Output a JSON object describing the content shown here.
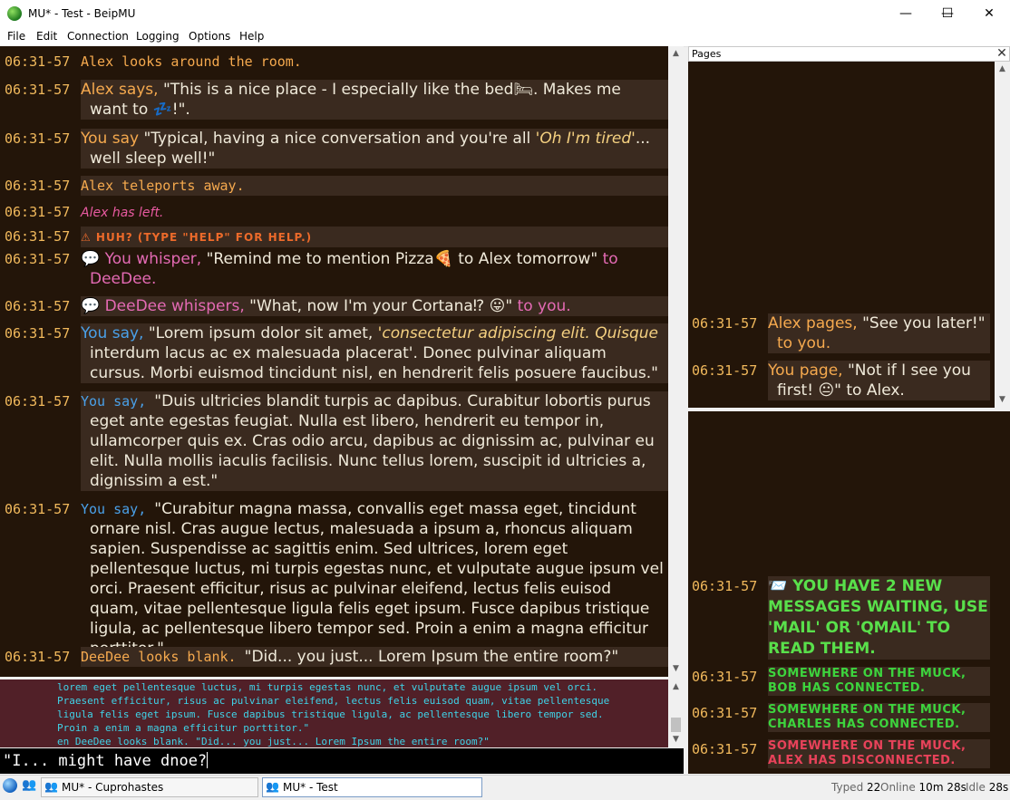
{
  "window": {
    "title": "MU* - Test - BeipMU",
    "minimize": "—",
    "maximize": "☐",
    "close": "✕"
  },
  "menu": [
    "File",
    "Edit",
    "Connection",
    "Logging",
    "Options",
    "Help"
  ],
  "main_lines": [
    {
      "ts": "06:31-57",
      "parts": [
        [
          "orange mono",
          "Alex looks around the room."
        ]
      ]
    },
    {
      "ts": "06:31-57",
      "parts": [
        [
          "orange",
          "Alex says, "
        ],
        [
          "",
          "\"This is a nice place - I especially like the bed🛏. Makes me"
        ]
      ],
      "cont": "want to 💤!\"."
    },
    {
      "ts": "06:31-57",
      "parts": [
        [
          "orange",
          "You say "
        ],
        [
          "",
          "\"Typical,  having a nice conversation and you're all "
        ],
        [
          "ital",
          "'Oh I'm tired'"
        ],
        [
          "",
          "..."
        ]
      ],
      "cont": "well sleep well!\""
    },
    {
      "ts": "06:31-57",
      "parts": [
        [
          "orange mono",
          "Alex teleports away."
        ]
      ]
    },
    {
      "ts": "06:31-57",
      "parts": [
        [
          "pinkit",
          "Alex has left."
        ]
      ]
    },
    {
      "ts": "06:31-57",
      "parts": [
        [
          "huh",
          "⚠ HUH?  (TYPE \"HELP\" FOR HELP.)"
        ]
      ]
    },
    {
      "ts": "06:31-57",
      "parts": [
        [
          "",
          "💬 "
        ],
        [
          "pink",
          "You whisper, "
        ],
        [
          "",
          "\"Remind me to mention Pizza🍕 to Alex tomorrow\" "
        ],
        [
          "pink",
          "to"
        ]
      ],
      "cont": "DeeDee.",
      "contclass": "pink"
    },
    {
      "ts": "06:31-57",
      "parts": [
        [
          "",
          "💬 "
        ],
        [
          "pink",
          "DeeDee whispers, "
        ],
        [
          "",
          "\"What, now I'm your Cortana⁉ 😛\" "
        ],
        [
          "pink",
          "to you."
        ]
      ]
    },
    {
      "ts": "06:31-57",
      "parts": [
        [
          "blue",
          "You say, "
        ],
        [
          "",
          " \"Lorem ipsum dolor sit amet, "
        ],
        [
          "ital",
          "'consectetur adipiscing elit. Quisque"
        ]
      ],
      "cont": "interdum lacus ac ex malesuada placerat'. Donec pulvinar aliquam cursus. Morbi euismod tincidunt nisl, en hendrerit felis posuere faucibus.\""
    },
    {
      "ts": "06:31-57",
      "parts": [
        [
          "blue mono",
          "You say, "
        ],
        [
          "",
          " \"Duis ultricies blandit turpis ac dapibus. Curabitur lobortis purus"
        ]
      ],
      "cont": "eget ante egestas feugiat. Nulla est libero, hendrerit eu tempor in, ullamcorper quis ex. Cras odio arcu, dapibus ac dignissim ac, pulvinar eu elit. Nulla mollis iaculis facilisis. Nunc tellus lorem, suscipit id ultricies a, dignissim a est.\""
    },
    {
      "ts": "06:31-57",
      "parts": [
        [
          "blue mono",
          "You say, "
        ],
        [
          "",
          " \"Curabitur magna massa, convallis eget massa eget, tincidunt"
        ]
      ],
      "cont": "ornare nisl. Cras augue lectus, malesuada a ipsum a, rhoncus aliquam sapien. Suspendisse ac sagittis enim. Sed ultrices, lorem eget pellentesque luctus, mi turpis egestas nunc, et vulputate augue ipsum vel orci. Praesent efficitur, risus ac pulvinar eleifend, lectus felis euisod quam, vitae pellentesque ligula felis eget ipsum. Fusce dapibus tristique ligula, ac pellentesque libero tempor sed. Proin a enim a magna efficitur porttitor.\""
    },
    {
      "ts": "06:31-57",
      "parts": [
        [
          "orange mono",
          "DeeDee looks blank. "
        ],
        [
          "",
          "\"Did... you just... Lorem Ipsum the entire room?\""
        ]
      ]
    }
  ],
  "pages": {
    "label": "Pages",
    "close": "✕",
    "top": [
      {
        "ts": "06:31-57",
        "parts": [
          [
            "orange",
            "Alex pages, "
          ],
          [
            "",
            "\"See you later!\""
          ]
        ],
        "cont": "to you.",
        "contclass": "orange"
      },
      {
        "ts": "06:31-57",
        "parts": [
          [
            "orange",
            "You page, "
          ],
          [
            "",
            "\"Not if I see you"
          ]
        ],
        "cont": "first! 😐\" to Alex."
      }
    ],
    "bottom": [
      {
        "ts": "06:31-57",
        "cls": "lgreen",
        "text": "📨 YOU HAVE 2 NEW MESSAGES WAITING, USE 'MAIL' OR 'QMAIL' TO READ THEM."
      },
      {
        "ts": "06:31-57",
        "cls": "green",
        "text": "SOMEWHERE ON THE MUCK, BOB HAS CONNECTED."
      },
      {
        "ts": "06:31-57",
        "cls": "green",
        "text": "SOMEWHERE ON THE MUCK, CHARLES HAS CONNECTED."
      },
      {
        "ts": "06:31-57",
        "cls": "red",
        "text": "SOMEWHERE ON THE MUCK, ALEX HAS DISCONNECTED."
      }
    ]
  },
  "scrollback": "lorem eget pellentesque luctus, mi turpis egestas nunc, et vulputate augue ipsum vel orci.\nPraesent efficitur, risus ac pulvinar eleifend, lectus felis euisod quam, vitae pellentesque\nligula felis eget ipsum. Fusce dapibus tristique ligula, ac pellentesque libero tempor sed.\nProin a enim a magna efficitur porttitor.\"\nen DeeDee looks blank. \"Did... you just... Lorem Ipsum the entire room?\"",
  "input": {
    "value": "\"I... might have dnoe?"
  },
  "taskbar": {
    "tabs": [
      {
        "label": "MU* - Cuprohastes",
        "active": false
      },
      {
        "label": "MU* - Test",
        "active": true
      }
    ],
    "typed_label": "Typed",
    "typed": "22",
    "online_label": "Online",
    "online": "10m 28s",
    "idle_label": "Idle",
    "idle": "28s"
  },
  "colors": {
    "background": "#231509",
    "timestamp": "#f1b95c",
    "accent_blue": "#4aa0e8",
    "whisper_pink": "#e46ab4",
    "input_bg": "#000000",
    "scrollback_bg": "#512028"
  }
}
